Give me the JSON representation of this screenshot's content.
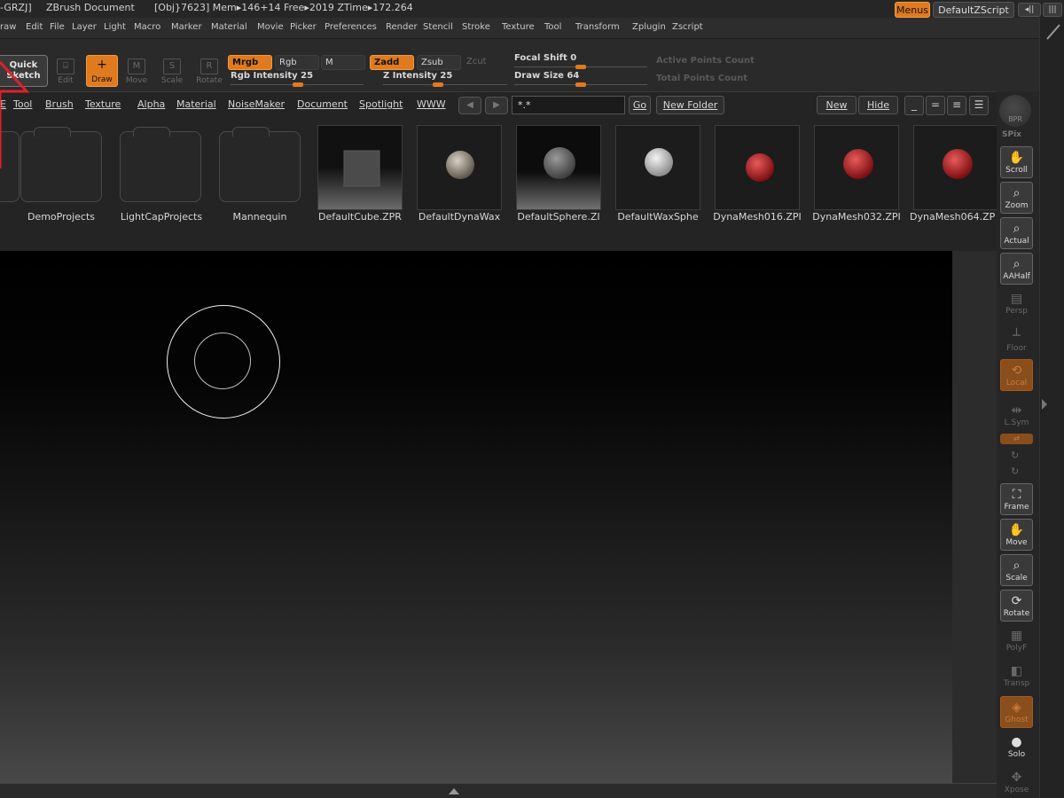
{
  "titlebar": {
    "prefix": "-GRZJ]",
    "doc": "ZBrush Document",
    "stats": "[Obj}7623] Mem▸146+14 Free▸2019 ZTime▸172.264",
    "menus_btn": "Menus",
    "zscript_btn": "DefaultZScript"
  },
  "menubar": {
    "items": [
      "raw",
      "Edit",
      "File",
      "Layer",
      "Light",
      "Macro",
      "Marker",
      "Material",
      "Movie",
      "Picker",
      "Preferences",
      "Render",
      "Stencil",
      "Stroke",
      "Texture",
      "Tool",
      "Transform",
      "Zplugin",
      "Zscript"
    ]
  },
  "shelf": {
    "quick_sketch": "Quick\nSketch",
    "edit": "Edit",
    "draw": "Draw",
    "move": "Move",
    "scale": "Scale",
    "rotate": "Rotate",
    "mrgb": "Mrgb",
    "rgb": "Rgb",
    "m": "M",
    "zadd": "Zadd",
    "zsub": "Zsub",
    "zcut": "Zcut",
    "rgb_intensity": "Rgb Intensity 25",
    "z_intensity": "Z Intensity 25",
    "focal_shift": "Focal Shift 0",
    "draw_size": "Draw Size 64",
    "active_points": "Active Points Count",
    "total_points": "Total Points Count",
    "values": {
      "rgb_intensity": 25,
      "z_intensity": 25,
      "focal_shift": 0,
      "draw_size": 64
    }
  },
  "lightbox": {
    "tabs": [
      "E",
      "Tool",
      "Brush",
      "Texture",
      "Alpha",
      "Material",
      "NoiseMaker",
      "Document",
      "Spotlight",
      "WWW"
    ],
    "search_value": "*.*",
    "go": "Go",
    "new_folder": "New Folder",
    "new": "New",
    "hide": "Hide",
    "folders": [
      "DemoProjects",
      "LightCapProjects",
      "Mannequin"
    ],
    "files": [
      "DefaultCube.ZPR",
      "DefaultDynaWax",
      "DefaultSphere.ZI",
      "DefaultWaxSphe",
      "DynaMesh016.ZPI",
      "DynaMesh032.ZPI",
      "DynaMesh064.ZP"
    ]
  },
  "right_shelf": {
    "bpr": "BPR",
    "spix": "SPix",
    "buttons": [
      "Scroll",
      "Zoom",
      "Actual",
      "AAHalf",
      "Persp",
      "Floor",
      "Local",
      "L.Sym",
      "Frame",
      "Move",
      "Scale",
      "Rotate",
      "PolyF",
      "Transp",
      "Ghost",
      "Solo",
      "Xpose"
    ]
  },
  "colors": {
    "accent": "#e07a1f",
    "panel": "#2a2a2a",
    "canvas_top": "#000000",
    "canvas_bottom": "#484848"
  }
}
